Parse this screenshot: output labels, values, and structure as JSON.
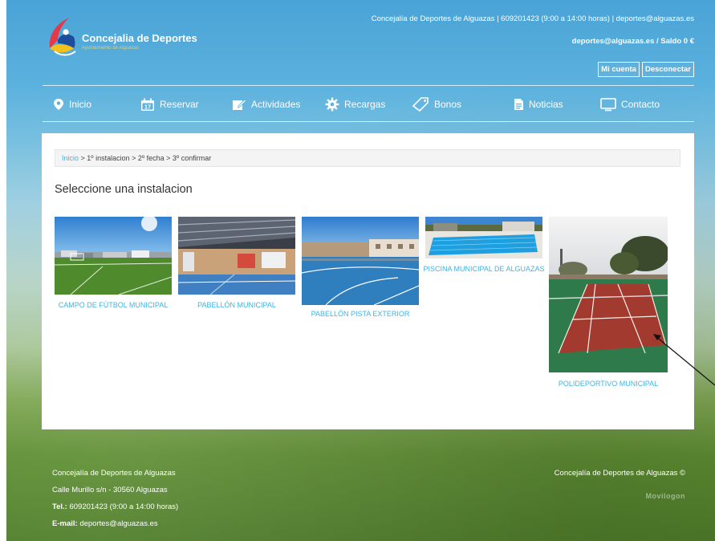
{
  "header": {
    "logo_title": "Concejalia de Deportes",
    "logo_subtitle": "Ayuntamiento de Alguazas",
    "contact_line": "Concejalía de Deportes de Alguazas | 609201423 (9:00 a 14:00 horas) | deportes@alguazas.es",
    "user_line": "deportes@alguazas.es / Saldo 0 €",
    "my_account": "Mi cuenta",
    "logout": "Desconectar"
  },
  "nav": {
    "items": [
      {
        "label": "Inicio",
        "icon": "map-pin-icon"
      },
      {
        "label": "Reservar",
        "icon": "calendar-icon"
      },
      {
        "label": "Actividades",
        "icon": "edit-icon"
      },
      {
        "label": "Recargas",
        "icon": "gear-icon"
      },
      {
        "label": "Bonos",
        "icon": "tag-icon"
      },
      {
        "label": "Noticias",
        "icon": "document-icon"
      },
      {
        "label": "Contacto",
        "icon": "monitor-icon"
      }
    ]
  },
  "breadcrumb": {
    "home": "Inicio",
    "rest": " > 1º instalacion > 2º fecha > 3º confirmar"
  },
  "page_title": "Seleccione una instalacion",
  "facilities": [
    {
      "label": "CAMPO DE FÚTBOL MUNICIPAL"
    },
    {
      "label": "PABELLÓN MUNICIPAL"
    },
    {
      "label": "PABELLÓN PISTA EXTERIOR"
    },
    {
      "label": "PISCINA MUNICIPAL DE ALGUAZAS"
    },
    {
      "label": "POLIDEPORTIVO MUNICIPAL"
    }
  ],
  "footer": {
    "org": "Concejalía de Deportes de Alguazas",
    "address": "Calle Murillo s/n - 30560 Alguazas",
    "tel_label": "Tel.:",
    "tel_value": " 609201423 (9:00 a 14:00 horas)",
    "email_label": "E-mail:",
    "email_value": " deportes@alguazas.es",
    "copyright": "Concejalía de Deportes de Alguazas ©",
    "brand": "Movilogon"
  },
  "colors": {
    "accent": "#3fb4e3",
    "header_bg": "#4aa3d6",
    "grass": "#5f8f33"
  }
}
